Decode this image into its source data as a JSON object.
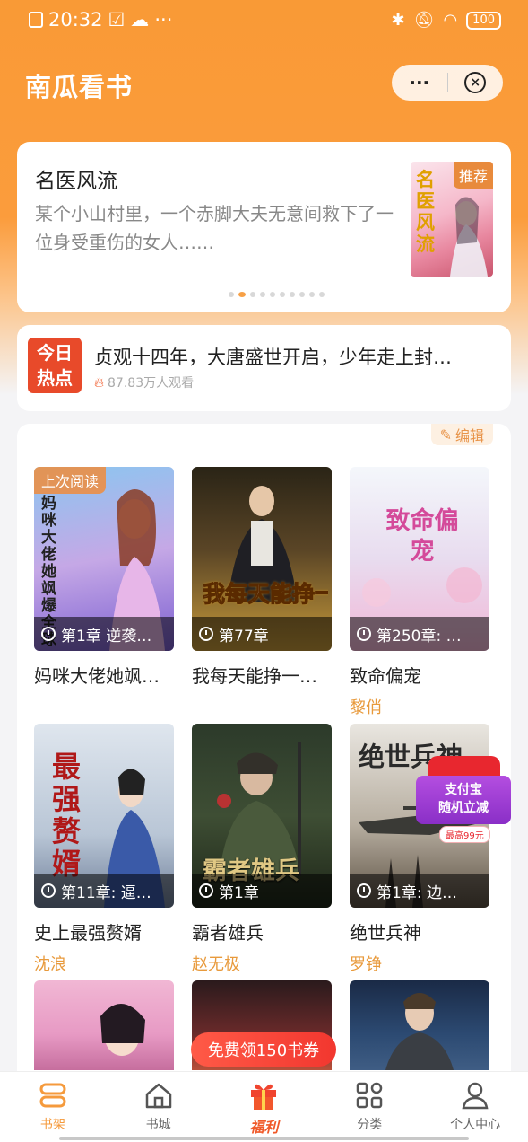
{
  "status_bar": {
    "time": "20:32",
    "more": "···",
    "battery": "100"
  },
  "header": {
    "app_title": "南瓜看书",
    "menu_label": "···",
    "close_label": "×"
  },
  "banner": {
    "title": "名医风流",
    "description": "某个小山村里，一个赤脚大夫无意间救下了一位身受重伤的女人……",
    "cover_title": "名医风流",
    "tag": "推荐",
    "page_count": 10,
    "active_page": 2
  },
  "hot": {
    "badge_line1": "今日",
    "badge_line2": "热点",
    "text": "贞观十四年，大唐盛世开启，少年走上封…",
    "views": "87.83万人观看"
  },
  "shelf": {
    "edit_label": "编辑",
    "last_read_label": "上次阅读",
    "books": [
      {
        "name": "妈咪大佬她飒…",
        "author": "",
        "progress": "第1章 逆袭…",
        "cover_text": "妈咪大佬她飒爆全球"
      },
      {
        "name": "我每天能挣一…",
        "author": "",
        "progress": "第77章",
        "cover_text": "我每天能挣一个亿"
      },
      {
        "name": "致命偏宠",
        "author": "黎俏",
        "progress": "第250章: …",
        "cover_text": "致命偏宠"
      },
      {
        "name": "史上最强赘婿",
        "author": "沈浪",
        "progress": "第11章: 逼…",
        "cover_text": "最强赘婿"
      },
      {
        "name": "霸者雄兵",
        "author": "赵无极",
        "progress": "第1章",
        "cover_text": "霸者雄兵"
      },
      {
        "name": "绝世兵神",
        "author": "罗铮",
        "progress": "第1章: 边…",
        "cover_text": "绝世兵神"
      }
    ]
  },
  "promo": {
    "line1": "支付宝",
    "line2": "随机立减",
    "note": "最高99元"
  },
  "coupon_label": "免费领150书券",
  "tabs": [
    {
      "label": "书架",
      "icon": "bookshelf-icon",
      "active": true
    },
    {
      "label": "书城",
      "icon": "home-icon",
      "active": false
    },
    {
      "label": "福利",
      "icon": "gift-icon",
      "active": false
    },
    {
      "label": "分类",
      "icon": "grid-icon",
      "active": false
    },
    {
      "label": "个人中心",
      "icon": "person-icon",
      "active": false
    }
  ],
  "colors": {
    "accent": "#f99a36",
    "author": "#e89a3c",
    "hot_badge": "#e84a2a",
    "coupon": "#f2372f"
  }
}
